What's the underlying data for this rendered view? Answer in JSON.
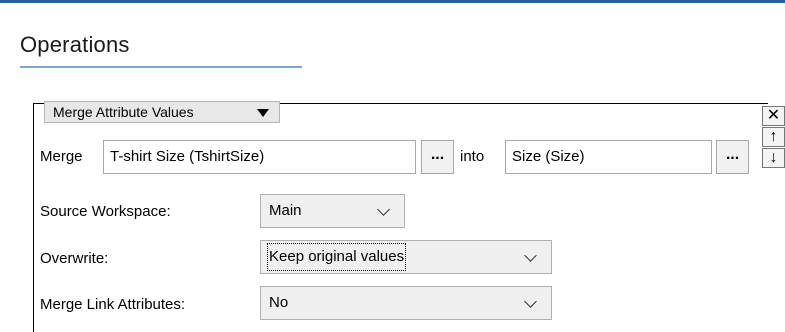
{
  "panel": {
    "title": "Operations"
  },
  "operation": {
    "selected": "Merge Attribute Values"
  },
  "merge_row": {
    "merge_label": "Merge",
    "source_value": "T-shirt Size (TshirtSize)",
    "browse_label": "...",
    "into_label": "into",
    "target_value": "Size (Size)"
  },
  "side_controls": {
    "close": "✕",
    "up": "↑",
    "down": "↓"
  },
  "source_workspace": {
    "label": "Source Workspace:",
    "value": "Main"
  },
  "overwrite": {
    "label": "Overwrite:",
    "value": "Keep original values"
  },
  "merge_link_attributes": {
    "label": "Merge Link Attributes:",
    "value": "No"
  },
  "colors": {
    "accent": "#1f5fa3",
    "underline": "#7fa7cc"
  }
}
